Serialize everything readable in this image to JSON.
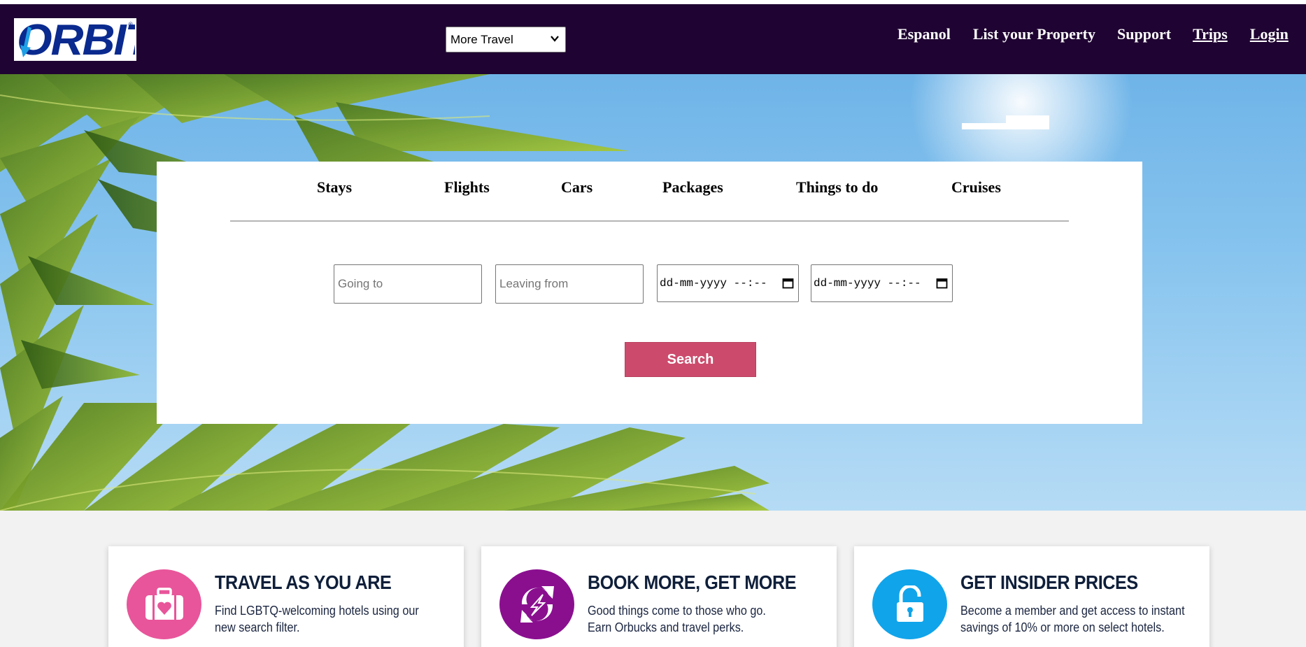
{
  "brand": {
    "logo_text": "ORBITZ",
    "logo_color": "#0a2a8f"
  },
  "header": {
    "background": "#1f0332",
    "more_travel_select": {
      "selected": "More Travel"
    },
    "nav": {
      "espanol": "Espanol",
      "list_property": "List your Property",
      "support": "Support",
      "trips": "Trips",
      "login": "Login"
    }
  },
  "search": {
    "tabs": [
      "Stays",
      "Flights",
      "Cars",
      "Packages",
      "Things to do",
      "Cruises"
    ],
    "going_to": {
      "placeholder": "Going to",
      "value": ""
    },
    "leaving_from": {
      "placeholder": "Leaving from",
      "value": ""
    },
    "start_date": {
      "display": "dd-mm-yyyy --:--"
    },
    "end_date": {
      "display": "dd-mm-yyyy --:--"
    },
    "search_button": "Search",
    "button_color": "#cc4b6c"
  },
  "features": [
    {
      "title": "TRAVEL AS YOU ARE",
      "line1": "Find LGBTQ-welcoming hotels using our",
      "line2": "new search filter.",
      "icon": "suitcase-heart-icon",
      "color": "#e8559a"
    },
    {
      "title": "BOOK MORE, GET MORE",
      "line1": "Good things come to those who go.",
      "line2": "Earn Orbucks and travel perks.",
      "icon": "orbucks-icon",
      "color": "#8a0f8f"
    },
    {
      "title": "GET INSIDER PRICES",
      "line1": "Become a member and get access to instant",
      "line2": "savings of 10% or more on select hotels.",
      "icon": "unlock-icon",
      "color": "#10a4ea"
    }
  ]
}
